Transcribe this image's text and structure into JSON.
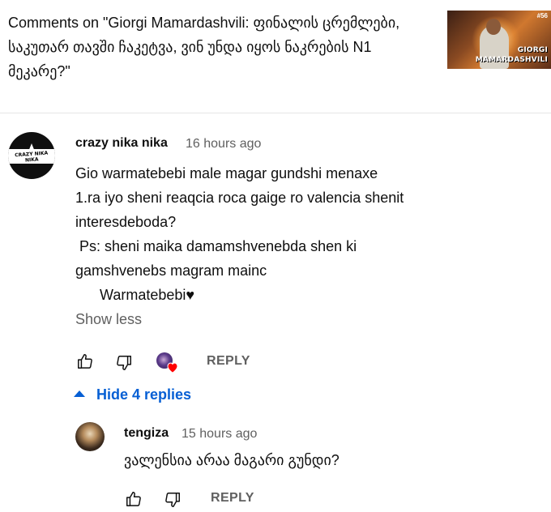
{
  "header": {
    "title": "Comments on \"Giorgi Mamardashvili: ფინალის ცრემლები, საკუთარ თავში ჩაკეტვა, ვინ უნდა იყოს ნაკრების N1 მეკარე?\"",
    "thumbnail": {
      "episode": "#56",
      "name_line1": "GIORGI",
      "name_line2": "MAMARDASHVILI"
    }
  },
  "comment": {
    "author": "crazy nika nika",
    "time": "16 hours ago",
    "avatar_text": "CRAZY NIKA NIKA",
    "lines": [
      "Gio warmatebebi male magar gundshi menaxe",
      "1.ra iyo sheni reaqcia roca gaige ro valencia shenit",
      "interesdeboda?",
      " Ps: sheni maika damamshvenebda shen ki",
      "gamshvenebs magram mainc",
      "      Warmatebebi♥"
    ],
    "show_less": "Show less",
    "reply_label": "REPLY"
  },
  "replies_toggle": {
    "label": "Hide 4 replies"
  },
  "reply": {
    "author": "tengiza",
    "time": "15 hours ago",
    "text": "ვალენსია არაა მაგარი გუნდი?",
    "reply_label": "REPLY"
  },
  "icons": {
    "like": "thumbs-up-icon",
    "dislike": "thumbs-down-icon",
    "heart": "creator-heart-icon",
    "collapse": "caret-up-icon"
  },
  "colors": {
    "link": "#065fd4",
    "secondary": "#606060",
    "heart": "#ff0000"
  }
}
